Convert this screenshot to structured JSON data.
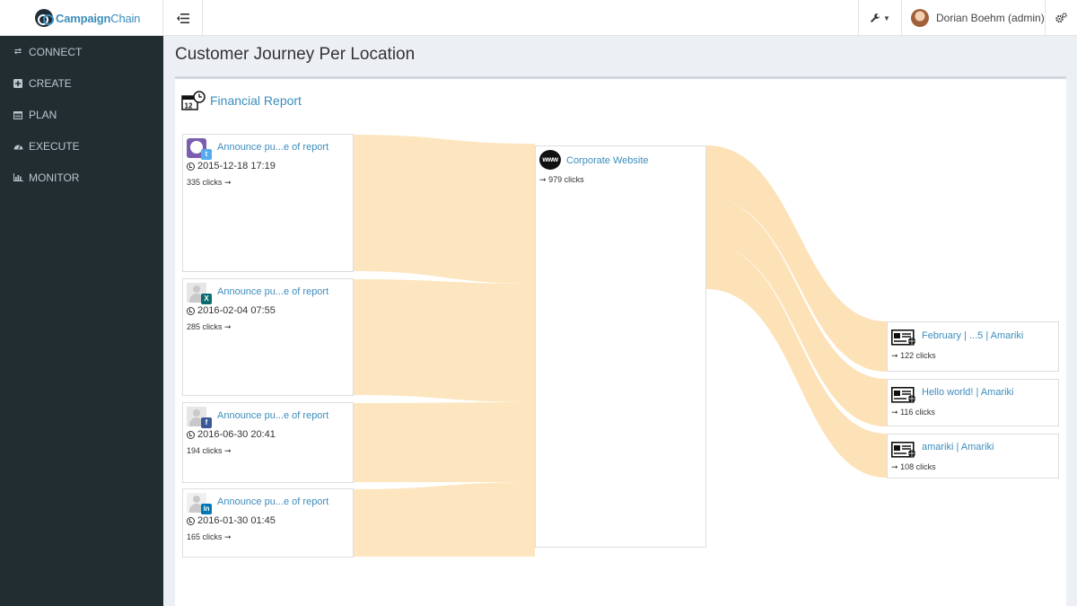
{
  "app": {
    "logo_bold": "Campaign",
    "logo_rest": "Chain"
  },
  "header": {
    "user": "Dorian Boehm (admin)"
  },
  "sidebar": {
    "items": [
      {
        "label": "CONNECT",
        "icon": "exchange-icon"
      },
      {
        "label": "CREATE",
        "icon": "plus-square-icon"
      },
      {
        "label": "PLAN",
        "icon": "calendar-icon"
      },
      {
        "label": "EXECUTE",
        "icon": "dashboard-icon"
      },
      {
        "label": "MONITOR",
        "icon": "bar-chart-icon"
      }
    ]
  },
  "page": {
    "title": "Customer Journey Per Location",
    "report_link": "Financial Report"
  },
  "sources": [
    {
      "title": "Announce pu...e of report",
      "date": "2015-12-18 17:19",
      "clicks": "335 clicks",
      "network": "twitter"
    },
    {
      "title": "Announce pu...e of report",
      "date": "2016-02-04 07:55",
      "clicks": "285 clicks",
      "network": "xing"
    },
    {
      "title": "Announce pu...e of report",
      "date": "2016-06-30 20:41",
      "clicks": "194 clicks",
      "network": "facebook"
    },
    {
      "title": "Announce pu...e of report",
      "date": "2016-01-30 01:45",
      "clicks": "165 clicks",
      "network": "linkedin"
    }
  ],
  "hub": {
    "title": "Corporate Website",
    "icon_text": "www",
    "clicks": "979 clicks"
  },
  "targets": [
    {
      "title": "February | ...5 | Amariki",
      "clicks": "122 clicks"
    },
    {
      "title": "Hello world! | Amariki",
      "clicks": "116 clicks"
    },
    {
      "title": "amariki | Amariki",
      "clicks": "108 clicks"
    }
  ],
  "colors": {
    "flow": "#fde3b8",
    "link": "#3c8dbc",
    "sidebar": "#222d32"
  }
}
